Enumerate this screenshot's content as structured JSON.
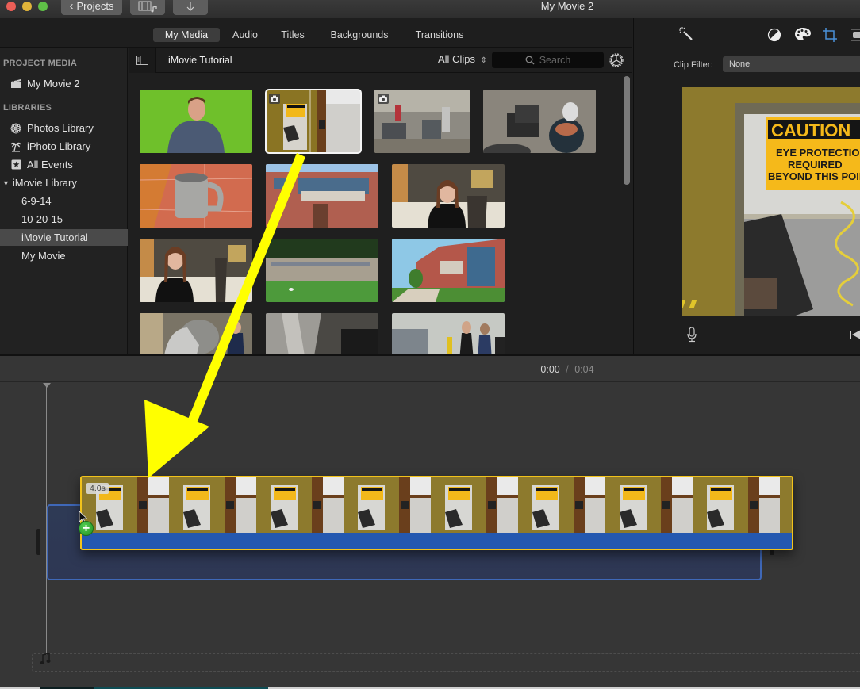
{
  "window": {
    "title": "My Movie 2",
    "traffic_lights": {
      "close": "#ec5f57",
      "minimize": "#e0b43a",
      "zoom": "#5fbf47"
    },
    "projects_button": "Projects",
    "media_toggle_icon": "film-music-icon",
    "import_icon": "download-arrow-icon"
  },
  "browser_tabs": [
    {
      "label": "My Media",
      "active": true
    },
    {
      "label": "Audio",
      "active": false
    },
    {
      "label": "Titles",
      "active": false
    },
    {
      "label": "Backgrounds",
      "active": false
    },
    {
      "label": "Transitions",
      "active": false
    }
  ],
  "sidebar": {
    "project_media_header": "PROJECT MEDIA",
    "project_item": {
      "label": "My Movie 2",
      "icon": "clapperboard-icon"
    },
    "libraries_header": "LIBRARIES",
    "libraries": [
      {
        "label": "Photos Library",
        "icon": "photos-flower-icon"
      },
      {
        "label": "iPhoto Library",
        "icon": "palm-tree-icon"
      },
      {
        "label": "All Events",
        "icon": "star-box-icon"
      }
    ],
    "imovie_library": {
      "label": "iMovie Library",
      "expanded": true
    },
    "events": [
      {
        "label": "6-9-14",
        "selected": false
      },
      {
        "label": "10-20-15",
        "selected": false
      },
      {
        "label": "iMovie Tutorial",
        "selected": true
      },
      {
        "label": "My Movie",
        "selected": false
      }
    ]
  },
  "browser_header": {
    "event_title": "iMovie Tutorial",
    "clips_filter": "All Clips",
    "search_placeholder": "Search"
  },
  "media_clips": [
    {
      "name": "man-green-screen",
      "type": "video"
    },
    {
      "name": "caution-sign-door",
      "type": "photo",
      "selected": true
    },
    {
      "name": "foundry-workshop",
      "type": "photo"
    },
    {
      "name": "casting-molds",
      "type": "video"
    },
    {
      "name": "pewter-mug",
      "type": "video"
    },
    {
      "name": "campus-building-entrance",
      "type": "video"
    },
    {
      "name": "woman-interview-1",
      "type": "video"
    },
    {
      "name": "woman-interview-2",
      "type": "video"
    },
    {
      "name": "university-sign-wall",
      "type": "video"
    },
    {
      "name": "campus-building-lawn",
      "type": "video"
    },
    {
      "name": "foundry-worker-suit",
      "type": "video"
    },
    {
      "name": "protective-suit-closeup",
      "type": "video"
    },
    {
      "name": "students-at-machine",
      "type": "video"
    }
  ],
  "viewer": {
    "toolbar_icons": [
      "magic-wand-icon",
      "color-balance-icon",
      "color-palette-icon",
      "crop-icon",
      "stabilization-icon"
    ],
    "active_tool": "crop-icon",
    "clip_filter_label": "Clip Filter:",
    "clip_filter_value": "None",
    "preview_sign": {
      "heading": "CAUTION",
      "line1": "EYE PROTECTION",
      "line2": "REQUIRED",
      "line3": "BEYOND THIS POINT"
    },
    "accent_color": "#4a90d9"
  },
  "timeline": {
    "current_time": "0:00",
    "separator": "/",
    "total_time": "0:04",
    "dragged_clip": {
      "duration": "4.0s",
      "border_color": "#f2c31b",
      "audio_bar_color": "#2458b0",
      "frame_count": 9
    },
    "add_badge": "+",
    "music_well_icon": "music-note-icon"
  },
  "annotation": {
    "arrow_color": "#ffff00",
    "description": "drag arrow from media browser clip to timeline"
  }
}
